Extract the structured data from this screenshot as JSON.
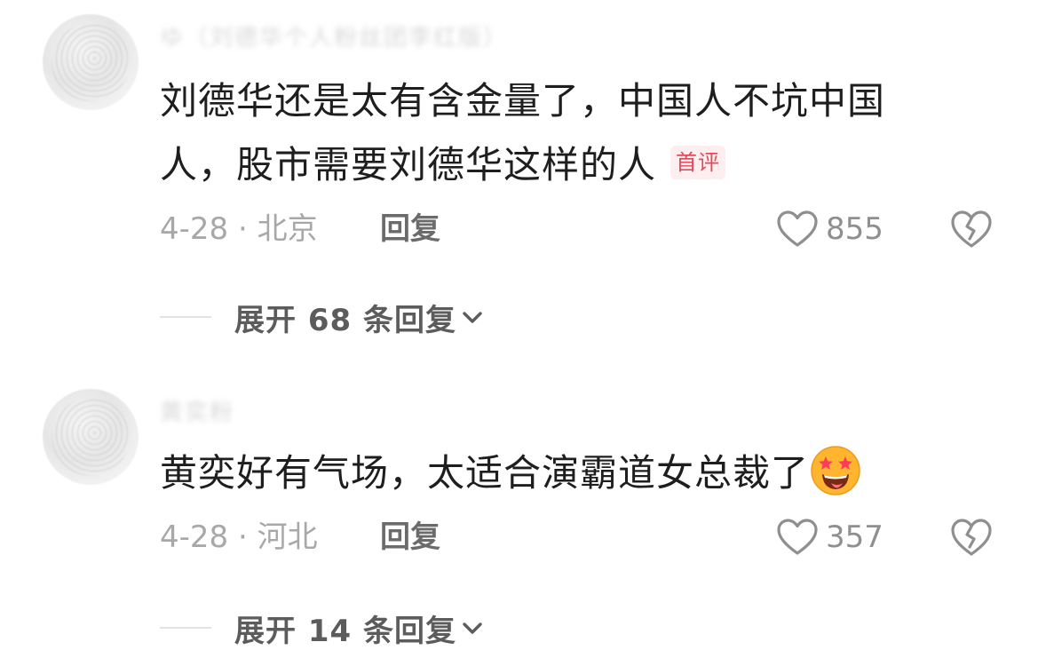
{
  "comments": [
    {
      "username": "ゆ（刘德华个人粉丝团李红版）",
      "text": "刘德华还是太有含金量了，中国人不坑中国人，股市需要刘德华这样的人",
      "badge": "首评",
      "date": "4-28 · 北京",
      "reply_label": "回复",
      "likes": "855",
      "expand_label": "展开 68 条回复"
    },
    {
      "username": "黄奕粉",
      "text": "黄奕好有气场，太适合演霸道女总裁了",
      "emoji": "star-struck-emoji",
      "date": "4-28 · 河北",
      "reply_label": "回复",
      "likes": "357",
      "expand_label": "展开 14 条回复"
    }
  ],
  "colors": {
    "badge_text": "#e34a5c",
    "badge_bg": "#fdeef0",
    "meta_text": "#a8a8a8",
    "icon": "#8f8f8f"
  },
  "icons": {
    "like": "heart-outline-icon",
    "dislike": "broken-heart-icon",
    "expand": "chevron-down-icon"
  }
}
